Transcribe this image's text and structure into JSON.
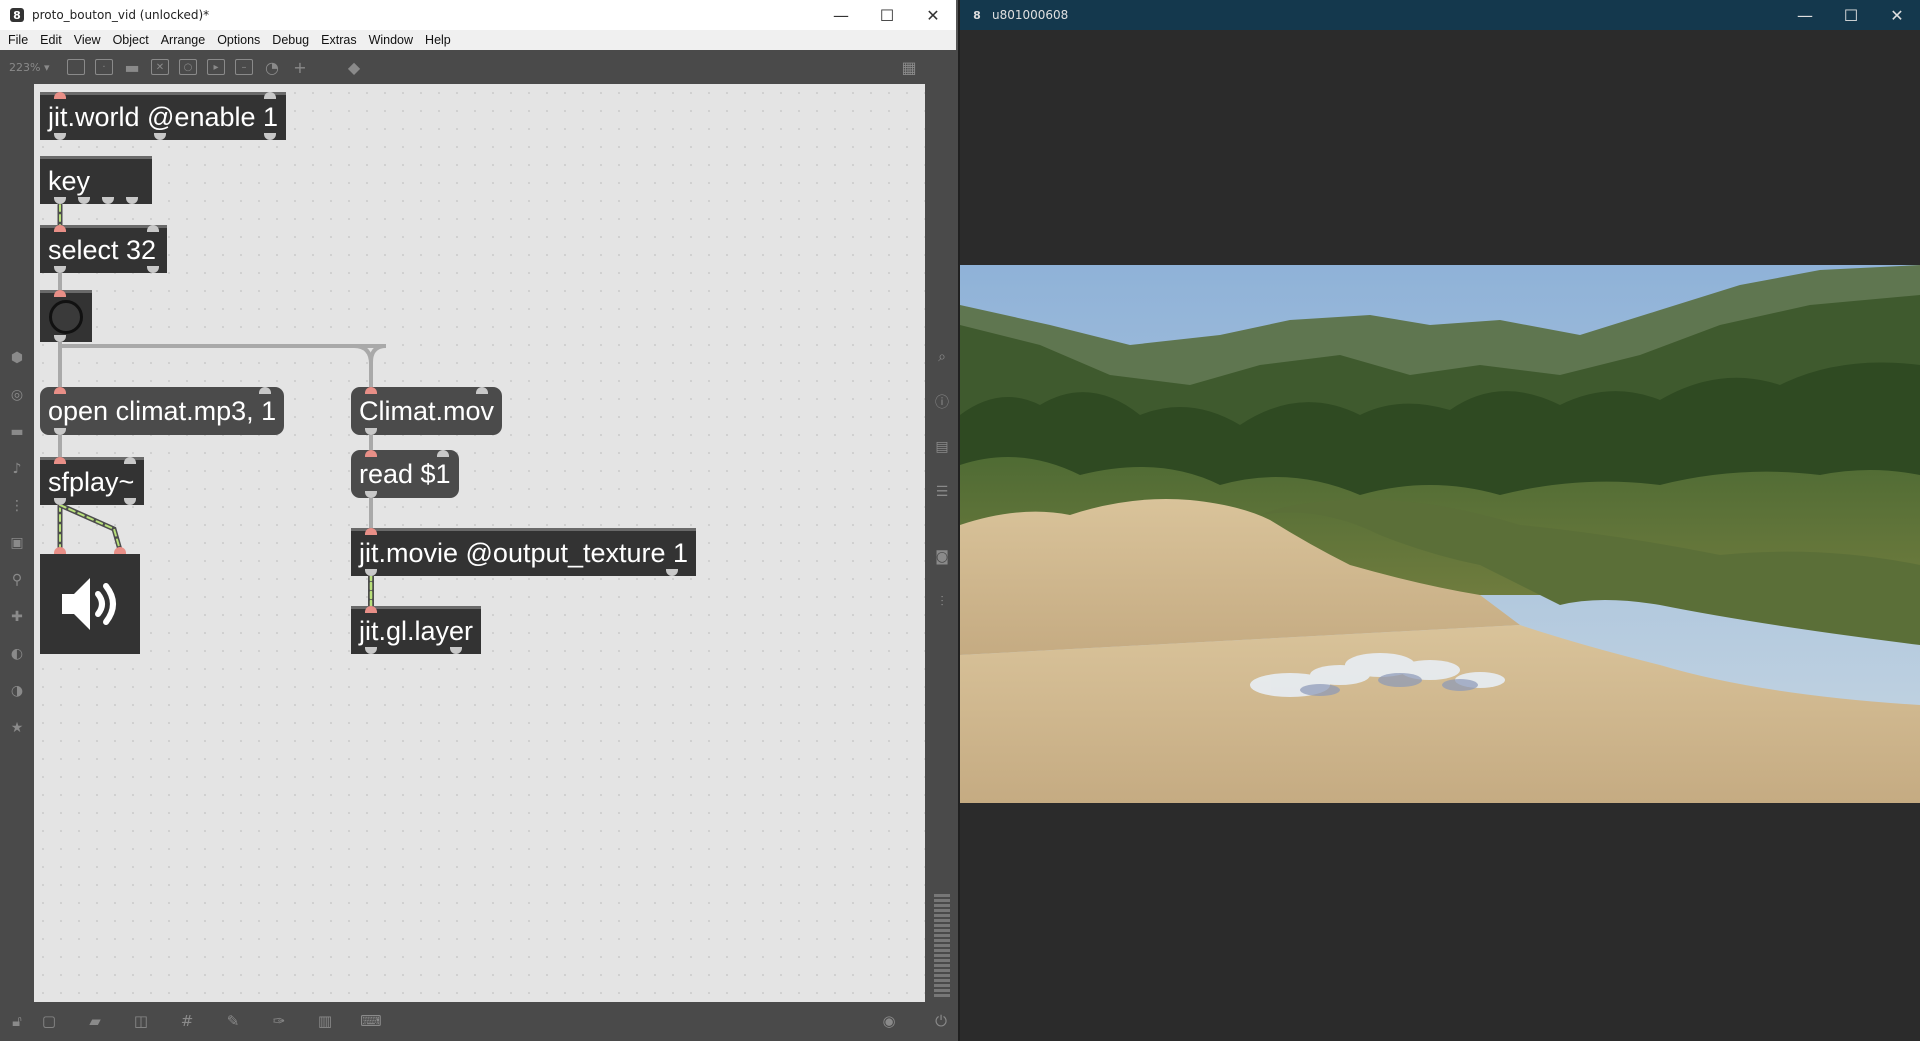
{
  "max_window": {
    "title": "proto_bouton_vid (unlocked)*",
    "app_icon": "max-icon",
    "controls": {
      "minimize": "—",
      "maximize": "☐",
      "close": "✕"
    },
    "menu": [
      "File",
      "Edit",
      "View",
      "Object",
      "Arrange",
      "Options",
      "Debug",
      "Extras",
      "Window",
      "Help"
    ],
    "toolbar": {
      "zoom": "223% ▾"
    }
  },
  "patch": {
    "objects": {
      "jit_world": "jit.world @enable 1",
      "key": "key",
      "select": "select 32",
      "open_msg": "open climat.mp3, 1",
      "sfplay": "sfplay~",
      "climat_msg": "Climat.mov",
      "read_msg": "read $1",
      "jit_movie": "jit.movie @output_texture 1",
      "jit_gl_layer": "jit.gl.layer"
    },
    "colors": {
      "object_bg": "#333333",
      "message_bg": "#4b4b4b",
      "signal_cord": "#b8e07a",
      "cord": "#a9a9a9",
      "hot_inlet": "#e88f87"
    }
  },
  "jitter_window": {
    "title": "u801000608",
    "controls": {
      "minimize": "—",
      "maximize": "☐",
      "close": "✕"
    }
  }
}
